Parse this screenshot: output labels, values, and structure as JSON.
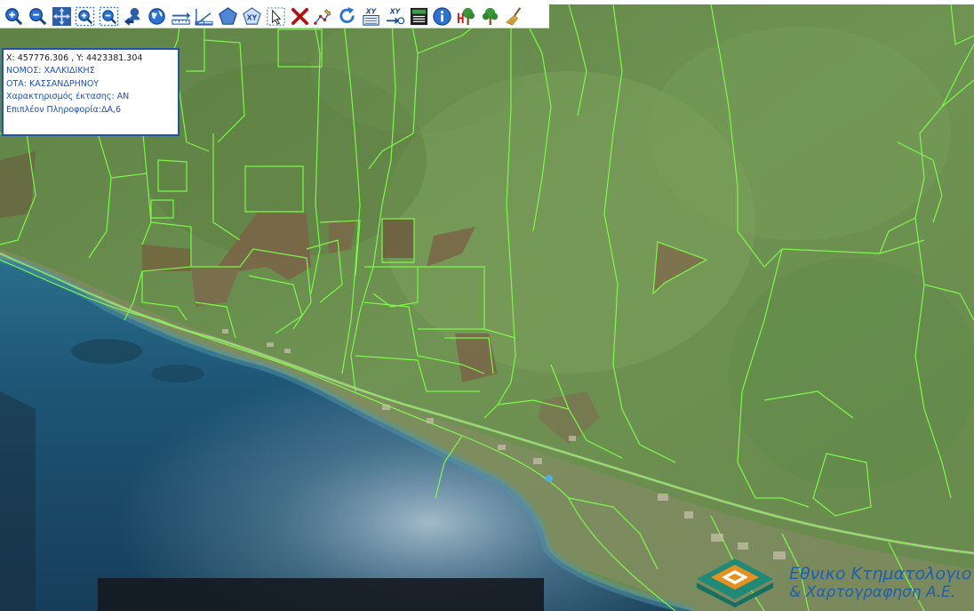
{
  "toolbar": {
    "tools": [
      {
        "name": "zoom-in",
        "icon": "zoom-in-icon"
      },
      {
        "name": "zoom-out",
        "icon": "zoom-out-icon"
      },
      {
        "name": "pan",
        "icon": "pan-icon"
      },
      {
        "name": "zoom-box-in",
        "icon": "zoom-box-in-icon"
      },
      {
        "name": "zoom-box-out",
        "icon": "zoom-box-out-icon"
      },
      {
        "name": "previous-extent",
        "icon": "previous-extent-icon"
      },
      {
        "name": "full-extent",
        "icon": "globe-icon"
      },
      {
        "name": "measure-distance",
        "icon": "measure-distance-icon"
      },
      {
        "name": "measure-angle",
        "icon": "measure-angle-icon"
      },
      {
        "name": "measure-area",
        "icon": "measure-area-icon"
      },
      {
        "name": "coordinates",
        "icon": "xy-icon",
        "label": "XY"
      },
      {
        "name": "select",
        "icon": "select-arrow-icon"
      },
      {
        "name": "clear",
        "icon": "clear-x-icon"
      },
      {
        "name": "edit-vertex",
        "icon": "edit-vertex-icon"
      },
      {
        "name": "refresh",
        "icon": "refresh-icon"
      },
      {
        "name": "coordinate-list",
        "icon": "xy-list-icon",
        "label": "XY"
      },
      {
        "name": "goto-coordinates",
        "icon": "xy-goto-icon",
        "label": "XY"
      },
      {
        "name": "print",
        "icon": "print-icon"
      },
      {
        "name": "info",
        "icon": "info-icon"
      },
      {
        "name": "tree-h",
        "icon": "tree-h-icon"
      },
      {
        "name": "tree",
        "icon": "tree-icon"
      },
      {
        "name": "broom",
        "icon": "broom-icon"
      }
    ]
  },
  "info_panel": {
    "coords": "X: 457776.306 , Y: 4423381.304",
    "lines": [
      "ΝΟΜΟΣ: ΧΑΛΚΙΔΙΚΗΣ",
      "ΟΤΑ: ΚΑΣΣΑΝΔΡΗΝΟΥ",
      "Χαρακτηρισμός έκτασης: ΑΝ",
      "Επιπλέον Πληροφορία:ΔΑ,6"
    ]
  },
  "logo": {
    "line1": "Εθνικο Κτηματολογιο",
    "line2": "& Χαρτογραφηση Α.Ε."
  },
  "colors": {
    "parcel_line": "#7dff4a",
    "land": "#6c8f4e",
    "sea": "#1f5a78",
    "info_border": "#2255aa",
    "info_text": "#1f4fbf",
    "logo_blue": "#1f5fb0",
    "logo_orange": "#e8901e",
    "logo_teal": "#1e8a77"
  }
}
